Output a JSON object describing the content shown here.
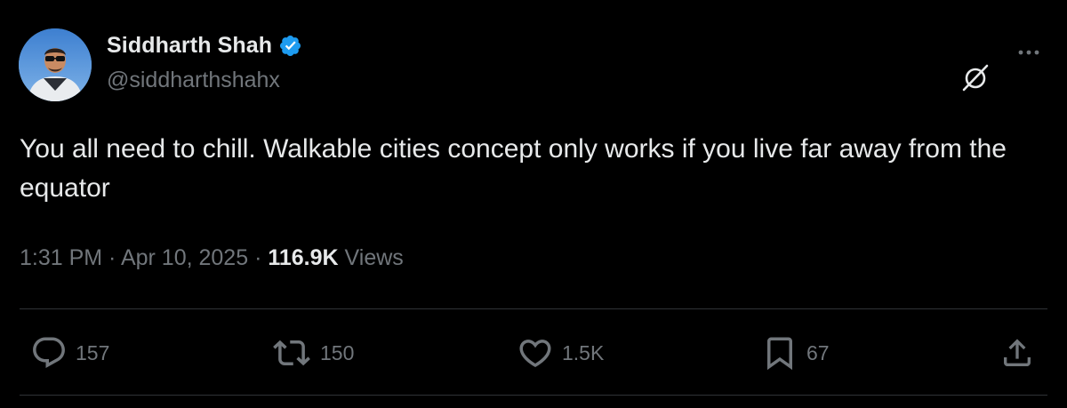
{
  "author": {
    "display_name": "Siddharth Shah",
    "handle": "@siddharthshahx",
    "verified": true
  },
  "tweet": {
    "text": "You all need to chill. Walkable cities concept only works if you live far away from the equator"
  },
  "meta": {
    "time": "1:31 PM",
    "separator1": " · ",
    "date": "Apr 10, 2025",
    "separator2": " · ",
    "views_count": "116.9K",
    "views_label": " Views"
  },
  "actions": {
    "replies": "157",
    "reposts": "150",
    "likes": "1.5K",
    "bookmarks": "67"
  },
  "icons": {
    "verified": "verified-badge-icon",
    "grok": "grok-icon",
    "more": "more-icon",
    "reply": "reply-icon",
    "repost": "repost-icon",
    "like": "heart-icon",
    "bookmark": "bookmark-icon",
    "share": "share-icon"
  },
  "colors": {
    "background": "#000000",
    "primary_text": "#e7e9ea",
    "secondary_text": "#71767b",
    "divider": "#2f3336",
    "verified": "#1d9bf0"
  }
}
